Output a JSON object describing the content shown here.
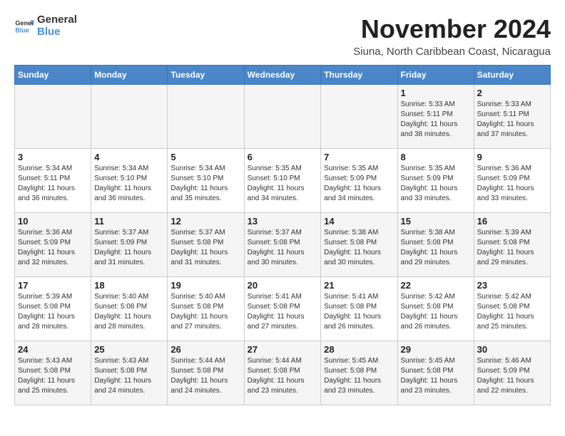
{
  "header": {
    "logo_general": "General",
    "logo_blue": "Blue",
    "month_title": "November 2024",
    "location": "Siuna, North Caribbean Coast, Nicaragua"
  },
  "days_of_week": [
    "Sunday",
    "Monday",
    "Tuesday",
    "Wednesday",
    "Thursday",
    "Friday",
    "Saturday"
  ],
  "weeks": [
    [
      {
        "day": "",
        "info": ""
      },
      {
        "day": "",
        "info": ""
      },
      {
        "day": "",
        "info": ""
      },
      {
        "day": "",
        "info": ""
      },
      {
        "day": "",
        "info": ""
      },
      {
        "day": "1",
        "info": "Sunrise: 5:33 AM\nSunset: 5:11 PM\nDaylight: 11 hours and 38 minutes."
      },
      {
        "day": "2",
        "info": "Sunrise: 5:33 AM\nSunset: 5:11 PM\nDaylight: 11 hours and 37 minutes."
      }
    ],
    [
      {
        "day": "3",
        "info": "Sunrise: 5:34 AM\nSunset: 5:11 PM\nDaylight: 11 hours and 36 minutes."
      },
      {
        "day": "4",
        "info": "Sunrise: 5:34 AM\nSunset: 5:10 PM\nDaylight: 11 hours and 36 minutes."
      },
      {
        "day": "5",
        "info": "Sunrise: 5:34 AM\nSunset: 5:10 PM\nDaylight: 11 hours and 35 minutes."
      },
      {
        "day": "6",
        "info": "Sunrise: 5:35 AM\nSunset: 5:10 PM\nDaylight: 11 hours and 34 minutes."
      },
      {
        "day": "7",
        "info": "Sunrise: 5:35 AM\nSunset: 5:09 PM\nDaylight: 11 hours and 34 minutes."
      },
      {
        "day": "8",
        "info": "Sunrise: 5:35 AM\nSunset: 5:09 PM\nDaylight: 11 hours and 33 minutes."
      },
      {
        "day": "9",
        "info": "Sunrise: 5:36 AM\nSunset: 5:09 PM\nDaylight: 11 hours and 33 minutes."
      }
    ],
    [
      {
        "day": "10",
        "info": "Sunrise: 5:36 AM\nSunset: 5:09 PM\nDaylight: 11 hours and 32 minutes."
      },
      {
        "day": "11",
        "info": "Sunrise: 5:37 AM\nSunset: 5:09 PM\nDaylight: 11 hours and 31 minutes."
      },
      {
        "day": "12",
        "info": "Sunrise: 5:37 AM\nSunset: 5:08 PM\nDaylight: 11 hours and 31 minutes."
      },
      {
        "day": "13",
        "info": "Sunrise: 5:37 AM\nSunset: 5:08 PM\nDaylight: 11 hours and 30 minutes."
      },
      {
        "day": "14",
        "info": "Sunrise: 5:38 AM\nSunset: 5:08 PM\nDaylight: 11 hours and 30 minutes."
      },
      {
        "day": "15",
        "info": "Sunrise: 5:38 AM\nSunset: 5:08 PM\nDaylight: 11 hours and 29 minutes."
      },
      {
        "day": "16",
        "info": "Sunrise: 5:39 AM\nSunset: 5:08 PM\nDaylight: 11 hours and 29 minutes."
      }
    ],
    [
      {
        "day": "17",
        "info": "Sunrise: 5:39 AM\nSunset: 5:08 PM\nDaylight: 11 hours and 28 minutes."
      },
      {
        "day": "18",
        "info": "Sunrise: 5:40 AM\nSunset: 5:08 PM\nDaylight: 11 hours and 28 minutes."
      },
      {
        "day": "19",
        "info": "Sunrise: 5:40 AM\nSunset: 5:08 PM\nDaylight: 11 hours and 27 minutes."
      },
      {
        "day": "20",
        "info": "Sunrise: 5:41 AM\nSunset: 5:08 PM\nDaylight: 11 hours and 27 minutes."
      },
      {
        "day": "21",
        "info": "Sunrise: 5:41 AM\nSunset: 5:08 PM\nDaylight: 11 hours and 26 minutes."
      },
      {
        "day": "22",
        "info": "Sunrise: 5:42 AM\nSunset: 5:08 PM\nDaylight: 11 hours and 26 minutes."
      },
      {
        "day": "23",
        "info": "Sunrise: 5:42 AM\nSunset: 5:08 PM\nDaylight: 11 hours and 25 minutes."
      }
    ],
    [
      {
        "day": "24",
        "info": "Sunrise: 5:43 AM\nSunset: 5:08 PM\nDaylight: 11 hours and 25 minutes."
      },
      {
        "day": "25",
        "info": "Sunrise: 5:43 AM\nSunset: 5:08 PM\nDaylight: 11 hours and 24 minutes."
      },
      {
        "day": "26",
        "info": "Sunrise: 5:44 AM\nSunset: 5:08 PM\nDaylight: 11 hours and 24 minutes."
      },
      {
        "day": "27",
        "info": "Sunrise: 5:44 AM\nSunset: 5:08 PM\nDaylight: 11 hours and 23 minutes."
      },
      {
        "day": "28",
        "info": "Sunrise: 5:45 AM\nSunset: 5:08 PM\nDaylight: 11 hours and 23 minutes."
      },
      {
        "day": "29",
        "info": "Sunrise: 5:45 AM\nSunset: 5:08 PM\nDaylight: 11 hours and 23 minutes."
      },
      {
        "day": "30",
        "info": "Sunrise: 5:46 AM\nSunset: 5:09 PM\nDaylight: 11 hours and 22 minutes."
      }
    ]
  ]
}
